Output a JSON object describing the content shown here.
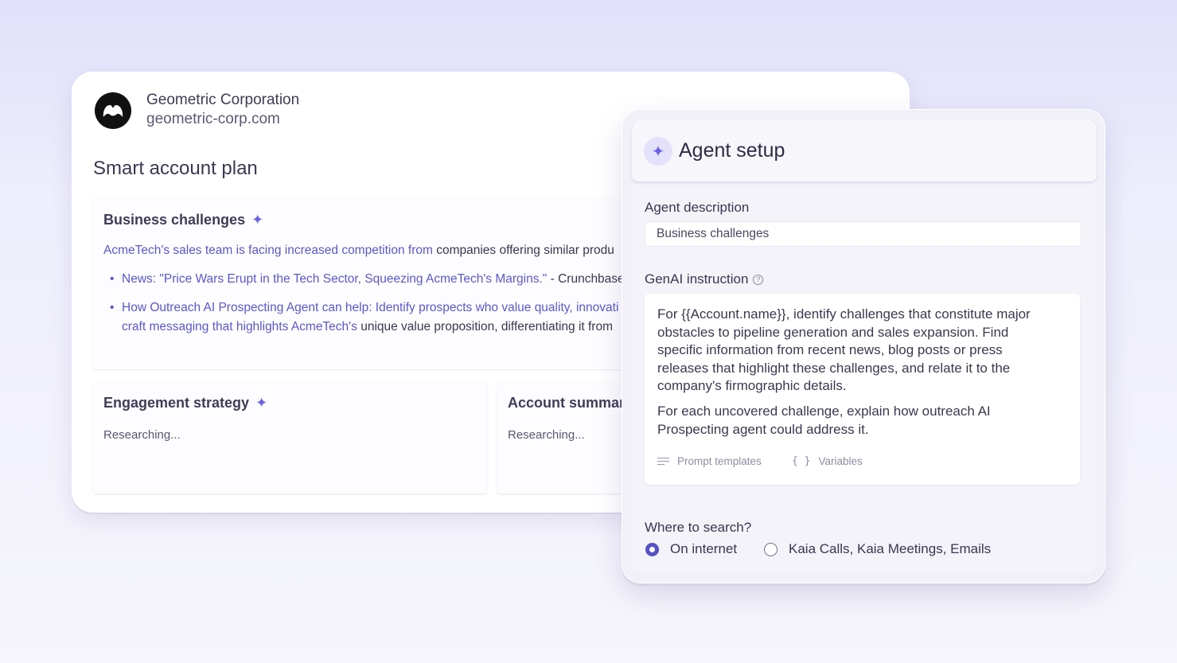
{
  "account_plan": {
    "company_name": "Geometric Corporation",
    "company_domain": "geometric-corp.com",
    "logo_icon": "geometric-logo-icon",
    "title": "Smart account plan",
    "business_challenges": {
      "title": "Business challenges",
      "intro_blue": "AcmeTech's sales team is facing increased competition from",
      "intro_dark": "companies offering similar produ",
      "bullet1_blue": "News: \"Price Wars Erupt in the Tech Sector, Squeezing AcmeTech's Margins.\"",
      "bullet1_dark": "- Crunchbase",
      "bullet2_line1_blue": "How Outreach AI Prospecting Agent can help: Identify prospects who value quality, innovati",
      "bullet2_line2_blue": "craft messaging that highlights AcmeTech's",
      "bullet2_line2_dark": "unique value proposition, differentiating it from"
    },
    "engagement_strategy": {
      "title": "Engagement strategy",
      "status": "Researching..."
    },
    "account_summary": {
      "title": "Account summar",
      "status": "Researching..."
    }
  },
  "agent_setup": {
    "title": "Agent setup",
    "description_label": "Agent description",
    "description_value": "Business challenges",
    "instruction_label": "GenAI instruction",
    "instruction_para1": "For {{Account.name}}, identify challenges that constitute major obstacles to pipeline generation and sales expansion. Find specific information from recent news, blog posts or press releases that highlight these challenges, and relate it to the company's firmographic details.",
    "instruction_para2": "For each uncovered challenge, explain how outreach AI Prospecting agent could address it.",
    "prompt_templates_label": "Prompt templates",
    "variables_label": "Variables",
    "search_label": "Where to search?",
    "search_options": [
      {
        "label": "On internet",
        "selected": true
      },
      {
        "label": "Kaia Calls, Kaia Meetings, Emails",
        "selected": false
      }
    ]
  },
  "colors": {
    "accent": "#6c63e6",
    "link_blue": "#5b57c9",
    "radio_selected": "#5651c4"
  }
}
